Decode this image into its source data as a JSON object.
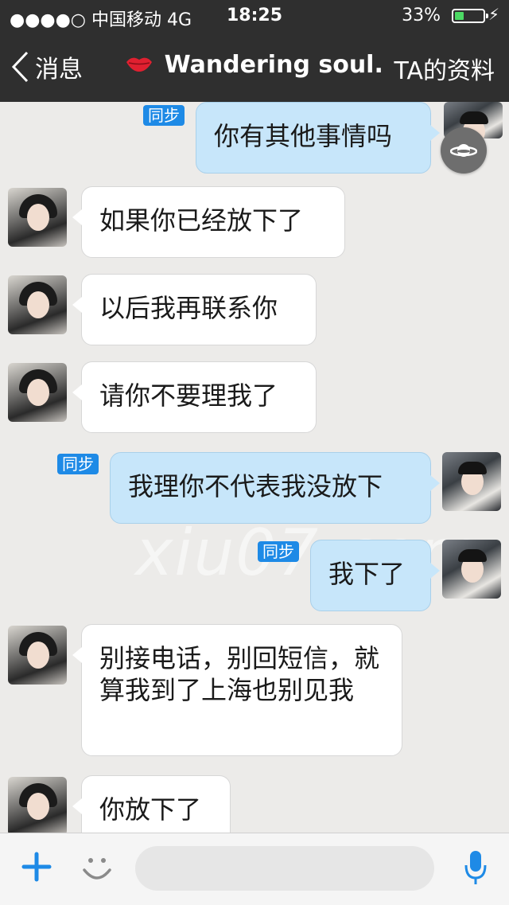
{
  "status_bar": {
    "carrier": "●●●●○ 中国移动  4G",
    "time": "18:25",
    "battery_percent": "33%",
    "battery_level": 0.33,
    "battery_color": "#4cd964"
  },
  "nav": {
    "back_label": "消息",
    "title_icon": "lips-icon",
    "title": "Wandering soul.",
    "profile_label": "TA的资料"
  },
  "watermark": "xiu07.com",
  "messages": [
    {
      "side": "out",
      "text": "你有其他事情吗",
      "sync_label": "同步"
    },
    {
      "side": "in",
      "text": "如果你已经放下了"
    },
    {
      "side": "in",
      "text": "以后我再联系你"
    },
    {
      "side": "in",
      "text": "请你不要理我了"
    },
    {
      "side": "out",
      "text": "我理你不代表我没放下",
      "sync_label": "同步"
    },
    {
      "side": "out",
      "text": "我下了",
      "sync_label": "同步"
    },
    {
      "side": "in",
      "text": "别接电话，别回短信，就算我到了上海也别见我"
    },
    {
      "side": "in",
      "text": "你放下了"
    }
  ],
  "input_bar": {
    "placeholder": "",
    "icons": [
      "plus-icon",
      "emoji-icon",
      "microphone-icon"
    ],
    "accent_color": "#1e8ae6"
  },
  "colors": {
    "bar_background": "#2f2f2f",
    "outgoing_bubble": "#c7e6fa",
    "incoming_bubble": "#ffffff",
    "sync_badge": "#1e8ae6"
  }
}
